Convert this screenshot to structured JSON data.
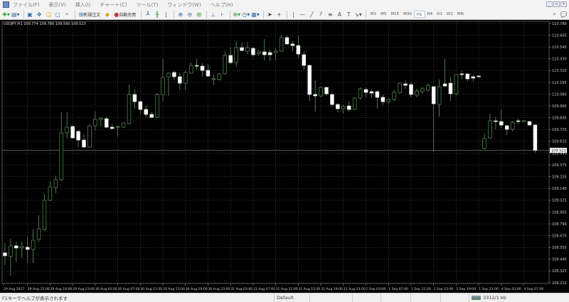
{
  "menu": [
    "ファイル(F)",
    "表示(V)",
    "挿入(I)",
    "チャート(C)",
    "ツール(T)",
    "ウィンドウ(W)",
    "ヘルプ(H)"
  ],
  "toolbar": {
    "new_order_label": "新規注文",
    "auto_trading_label": "自動売買",
    "timeframes": [
      "M1",
      "M5",
      "M15",
      "M30",
      "H1",
      "H4",
      "D1",
      "W1",
      "MN"
    ],
    "active_timeframe": "H1"
  },
  "chart": {
    "header": "USDJPY,H1  109.774 109.780 109.500 109.523",
    "current_price": "109.523"
  },
  "chart_data": {
    "type": "candlestick",
    "symbol": "USDJPY",
    "timeframe": "H1",
    "grid": true,
    "colors": {
      "bull_body": "#000000",
      "bull_outline": "#5f8f5f",
      "bear_body": "#ffffff",
      "wick": "#6a8f6a",
      "grid": "#6a6a6a",
      "background": "#000000"
    },
    "ylim": [
      108.21,
      110.78
    ],
    "y_ticks": [
      "110.780",
      "110.665",
      "110.545",
      "110.430",
      "110.310",
      "110.195",
      "110.080",
      "109.960",
      "109.845",
      "109.725",
      "109.610",
      "109.490",
      "109.375",
      "109.255",
      "109.140",
      "109.025",
      "108.905",
      "108.790",
      "108.670",
      "108.555",
      "108.440",
      "108.325",
      "108.210"
    ],
    "x_ticks": [
      "29 Aug 2017",
      "29 Aug 15:00",
      "29 Aug 19:00",
      "29 Aug 23:00",
      "30 Aug 03:00",
      "30 Aug 07:00",
      "30 Aug 11:00",
      "30 Aug 15:00",
      "30 Aug 19:00",
      "30 Aug 23:00",
      "31 Aug 03:00",
      "31 Aug 07:00",
      "31 Aug 11:00",
      "31 Aug 15:00",
      "31 Aug 19:00",
      "31 Aug 23:00",
      "1 Sep 03:00",
      "1 Sep 07:00",
      "1 Sep 11:00",
      "1 Sep 15:00",
      "1 Sep 19:00",
      "1 Sep 23:00",
      "4 Sep 03:00",
      "4 Sep 07:00"
    ],
    "ohlc": [
      [
        108.506,
        108.604,
        108.386,
        108.478
      ],
      [
        108.471,
        108.647,
        108.28,
        108.576
      ],
      [
        108.576,
        108.618,
        108.421,
        108.555
      ],
      [
        108.555,
        108.618,
        108.456,
        108.569
      ],
      [
        108.562,
        108.668,
        108.407,
        108.541
      ],
      [
        108.541,
        108.745,
        108.407,
        108.632
      ],
      [
        108.64,
        108.879,
        108.618,
        108.745
      ],
      [
        108.738,
        109.09,
        108.724,
        109.027
      ],
      [
        109.027,
        109.217,
        109.02,
        109.16
      ],
      [
        109.153,
        109.273,
        109.097,
        109.231
      ],
      [
        109.231,
        109.9,
        109.217,
        109.696
      ],
      [
        109.696,
        109.9,
        109.639,
        109.752
      ],
      [
        109.759,
        109.773,
        109.639,
        109.646
      ],
      [
        109.71,
        109.724,
        109.555,
        109.625
      ],
      [
        109.625,
        109.681,
        109.548,
        109.555
      ],
      [
        109.555,
        109.78,
        109.548,
        109.766
      ],
      [
        109.766,
        109.907,
        109.724,
        109.829
      ],
      [
        109.829,
        109.85,
        109.759,
        109.843
      ],
      [
        109.836,
        109.85,
        109.745,
        109.752
      ],
      [
        109.752,
        109.787,
        109.738,
        109.738
      ],
      [
        109.752,
        109.766,
        109.66,
        109.759
      ],
      [
        109.752,
        109.801,
        109.745,
        109.794
      ],
      [
        109.787,
        110.174,
        109.78,
        110.076
      ],
      [
        110.076,
        110.132,
        109.935,
        110.005
      ],
      [
        110.005,
        110.012,
        109.886,
        109.928
      ],
      [
        109.928,
        109.963,
        109.85,
        109.879
      ],
      [
        109.879,
        109.9,
        109.836,
        109.85
      ],
      [
        109.85,
        110.09,
        109.843,
        110.076
      ],
      [
        110.076,
        110.428,
        110.012,
        110.245
      ],
      [
        110.252,
        110.294,
        110.062,
        110.287
      ],
      [
        110.294,
        110.308,
        110.216,
        110.252
      ],
      [
        110.252,
        110.287,
        110.118,
        110.188
      ],
      [
        110.188,
        110.308,
        110.118,
        110.294
      ],
      [
        110.287,
        110.392,
        110.28,
        110.364
      ],
      [
        110.364,
        110.428,
        110.322,
        110.357
      ],
      [
        110.357,
        110.385,
        110.252,
        110.315
      ],
      [
        110.315,
        110.378,
        110.252,
        110.259
      ],
      [
        110.224,
        110.273,
        110.167,
        110.231
      ],
      [
        110.224,
        110.287,
        110.216,
        110.28
      ],
      [
        110.28,
        110.498,
        110.273,
        110.463
      ],
      [
        110.463,
        110.547,
        110.378,
        110.392
      ],
      [
        110.392,
        110.604,
        110.35,
        110.54
      ],
      [
        110.54,
        110.59,
        110.505,
        110.512
      ],
      [
        110.505,
        110.597,
        110.477,
        110.54
      ],
      [
        110.533,
        110.547,
        110.449,
        110.47
      ],
      [
        110.484,
        110.519,
        110.463,
        110.498
      ],
      [
        110.498,
        110.625,
        110.414,
        110.47
      ],
      [
        110.491,
        110.519,
        110.407,
        110.47
      ],
      [
        110.491,
        110.533,
        110.414,
        110.505
      ],
      [
        110.505,
        110.667,
        110.498,
        110.639
      ],
      [
        110.639,
        110.66,
        110.576,
        110.576
      ],
      [
        110.576,
        110.604,
        110.505,
        110.561
      ],
      [
        110.561,
        110.66,
        110.435,
        110.477
      ],
      [
        110.47,
        110.505,
        110.322,
        110.364
      ],
      [
        110.364,
        110.371,
        110.012,
        110.076
      ],
      [
        110.076,
        110.216,
        109.907,
        110.062
      ],
      [
        110.062,
        110.153,
        110.048,
        110.146
      ],
      [
        110.146,
        110.153,
        110.062,
        110.083
      ],
      [
        110.076,
        110.09,
        109.956,
        109.977
      ],
      [
        109.977,
        109.991,
        109.9,
        109.935
      ],
      [
        109.935,
        109.977,
        109.886,
        109.956
      ],
      [
        109.963,
        110.005,
        109.907,
        109.928
      ],
      [
        109.928,
        110.048,
        109.921,
        110.04
      ],
      [
        110.04,
        110.146,
        110.026,
        110.132
      ],
      [
        110.125,
        110.146,
        110.048,
        110.097
      ],
      [
        110.104,
        110.132,
        110.048,
        110.09
      ],
      [
        110.104,
        110.118,
        109.935,
        110.048
      ],
      [
        110.048,
        110.076,
        109.97,
        110.005
      ],
      [
        110.005,
        110.04,
        109.977,
        110.026
      ],
      [
        110.026,
        110.118,
        110.012,
        110.097
      ],
      [
        110.097,
        110.195,
        110.083,
        110.188
      ],
      [
        110.181,
        110.216,
        110.132,
        110.167
      ],
      [
        110.174,
        110.202,
        110.048,
        110.076
      ],
      [
        110.069,
        110.132,
        110.048,
        110.111
      ],
      [
        110.104,
        110.153,
        110.083,
        110.132
      ],
      [
        110.118,
        110.181,
        110.104,
        110.167
      ],
      [
        110.153,
        110.16,
        109.512,
        109.984
      ],
      [
        109.977,
        110.224,
        109.857,
        110.153
      ],
      [
        110.181,
        110.428,
        110.153,
        110.16
      ],
      [
        110.188,
        110.252,
        110.012,
        110.083
      ],
      [
        110.083,
        110.28,
        110.069,
        110.273
      ],
      [
        110.28,
        110.308,
        110.224,
        110.273
      ],
      [
        110.28,
        110.287,
        110.209,
        110.231
      ],
      [
        110.252,
        110.266,
        110.202,
        110.238
      ],
      [
        110.259,
        110.266,
        110.238,
        110.252
      ],
      [
        109.541,
        109.688,
        109.534,
        109.639
      ],
      [
        109.646,
        109.886,
        109.639,
        109.815
      ],
      [
        109.815,
        109.857,
        109.731,
        109.808
      ],
      [
        109.808,
        109.928,
        109.745,
        109.773
      ],
      [
        109.766,
        109.78,
        109.674,
        109.731
      ],
      [
        109.731,
        109.815,
        109.71,
        109.801
      ],
      [
        109.815,
        109.836,
        109.78,
        109.808
      ],
      [
        109.808,
        109.822,
        109.801,
        109.815
      ],
      [
        109.808,
        109.815,
        109.773,
        109.773
      ],
      [
        109.774,
        109.78,
        109.5,
        109.523
      ]
    ]
  },
  "status": {
    "help_text": "F1キーでヘルプが表示されます",
    "profile": "Default",
    "traffic": "3312/1 kb"
  }
}
